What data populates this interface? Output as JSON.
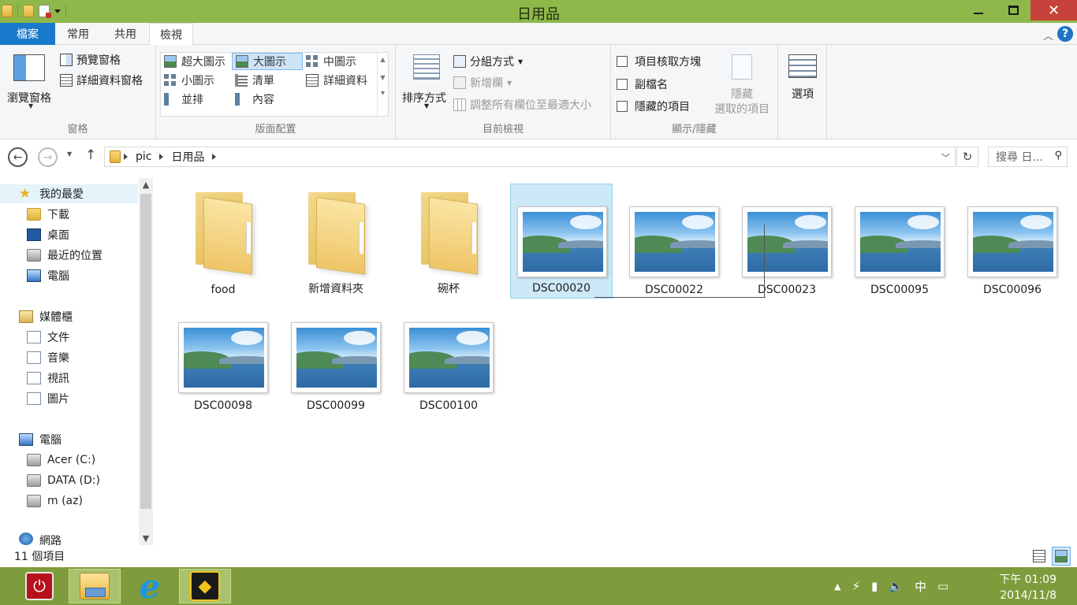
{
  "window": {
    "title": "日用品"
  },
  "ribbon_tabs": {
    "file": "檔案",
    "home": "常用",
    "share": "共用",
    "view": "檢視"
  },
  "ribbon": {
    "panes": {
      "nav_pane_label": "瀏覽窗格",
      "preview_pane": "預覽窗格",
      "details_pane": "詳細資料窗格",
      "group_label": "窗格"
    },
    "layout": {
      "items": [
        "超大圖示",
        "大圖示",
        "中圖示",
        "小圖示",
        "清單",
        "詳細資料",
        "並排",
        "內容"
      ],
      "selected": "大圖示",
      "group_label": "版面配置"
    },
    "current_view": {
      "sort_by": "排序方式",
      "group_by": "分組方式",
      "add_columns": "新增欄",
      "size_columns": "調整所有欄位至最適大小",
      "group_label": "目前檢視"
    },
    "show_hide": {
      "item_checkboxes": "項目核取方塊",
      "file_extensions": "副檔名",
      "hidden_items": "隱藏的項目",
      "hide_selected_line1": "隱藏",
      "hide_selected_line2": "選取的項目",
      "group_label": "顯示/隱藏"
    },
    "options": "選項"
  },
  "address": {
    "crumbs": [
      "pic",
      "日用品"
    ],
    "search_placeholder": "搜尋 日..."
  },
  "nav_pane": {
    "favorites": "我的最愛",
    "downloads": "下載",
    "desktop": "桌面",
    "recent": "最近的位置",
    "computer_fav": "電腦",
    "libraries": "媒體櫃",
    "documents": "文件",
    "music": "音樂",
    "videos": "視訊",
    "pictures": "圖片",
    "computer": "電腦",
    "drive_c": "Acer (C:)",
    "drive_d": "DATA (D:)",
    "drive_m": "m (az)",
    "network": "網路"
  },
  "files": [
    {
      "name": "food",
      "type": "folder"
    },
    {
      "name": "新增資料夾",
      "type": "folder"
    },
    {
      "name": "碗杯",
      "type": "folder"
    },
    {
      "name": "DSC00020",
      "type": "image",
      "selected": true
    },
    {
      "name": "DSC00022",
      "type": "image"
    },
    {
      "name": "DSC00023",
      "type": "image"
    },
    {
      "name": "DSC00095",
      "type": "image"
    },
    {
      "name": "DSC00096",
      "type": "image"
    },
    {
      "name": "DSC00098",
      "type": "image"
    },
    {
      "name": "DSC00099",
      "type": "image"
    },
    {
      "name": "DSC00100",
      "type": "image"
    }
  ],
  "status": {
    "item_count": "11 個項目"
  },
  "taskbar": {
    "clock_time": "下午 01:09",
    "clock_date": "2014/11/8",
    "ime": "中"
  },
  "colors": {
    "title_bar": "#8fb84a",
    "file_tab": "#1979ca",
    "selection": "#cde8f7",
    "taskbar": "#7e9c3c",
    "close_button": "#c7423a"
  }
}
